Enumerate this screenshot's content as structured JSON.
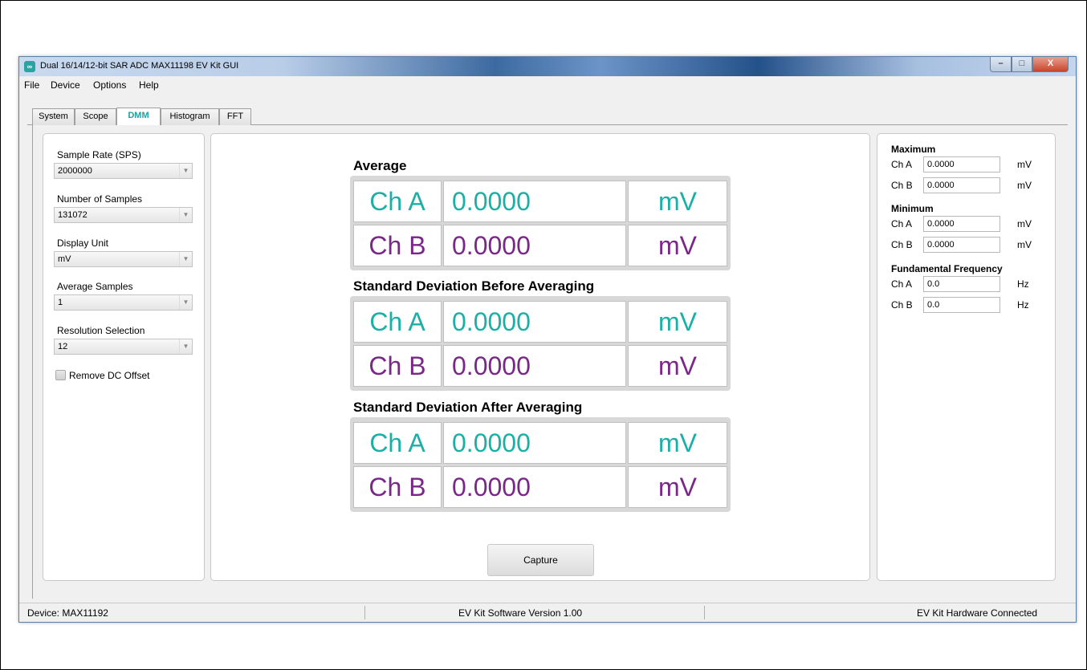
{
  "window": {
    "title": "Dual 16/14/12-bit SAR ADC MAX11198 EV Kit GUI",
    "app_icon_glyph": "∞",
    "controls": {
      "minimize": "–",
      "maximize": "□",
      "close": "X"
    }
  },
  "menu": [
    "File",
    "Device",
    "Options",
    "Help"
  ],
  "tabs": [
    {
      "label": "System",
      "active": false
    },
    {
      "label": "Scope",
      "active": false
    },
    {
      "label": "DMM",
      "active": true
    },
    {
      "label": "Histogram",
      "active": false
    },
    {
      "label": "FFT",
      "active": false
    }
  ],
  "left_panel": {
    "sample_rate": {
      "label": "Sample Rate (SPS)",
      "value": "2000000"
    },
    "num_samples": {
      "label": "Number of Samples",
      "value": "131072"
    },
    "display_unit": {
      "label": "Display Unit",
      "value": "mV"
    },
    "average_samples": {
      "label": "Average Samples",
      "value": "1"
    },
    "resolution": {
      "label": "Resolution Selection",
      "value": "12"
    },
    "remove_dc": {
      "label": "Remove DC Offset",
      "checked": false
    },
    "combo_arrow": "▼"
  },
  "readouts": {
    "average": {
      "title": "Average",
      "rows": [
        {
          "channel": "Ch A",
          "value": "0.0000",
          "unit": "mV"
        },
        {
          "channel": "Ch B",
          "value": "0.0000",
          "unit": "mV"
        }
      ]
    },
    "std_before": {
      "title": "Standard Deviation Before Averaging",
      "rows": [
        {
          "channel": "Ch A",
          "value": "0.0000",
          "unit": "mV"
        },
        {
          "channel": "Ch B",
          "value": "0.0000",
          "unit": "mV"
        }
      ]
    },
    "std_after": {
      "title": "Standard Deviation After Averaging",
      "rows": [
        {
          "channel": "Ch A",
          "value": "0.0000",
          "unit": "mV"
        },
        {
          "channel": "Ch B",
          "value": "0.0000",
          "unit": "mV"
        }
      ]
    },
    "colors": {
      "ch_a": "#1ab0a5",
      "ch_b": "#7a2888"
    }
  },
  "capture_button": "Capture",
  "right_panel": {
    "maximum": {
      "title": "Maximum",
      "rows": [
        {
          "label": "Ch A",
          "value": "0.0000",
          "unit": "mV"
        },
        {
          "label": "Ch B",
          "value": "0.0000",
          "unit": "mV"
        }
      ]
    },
    "minimum": {
      "title": "Minimum",
      "rows": [
        {
          "label": "Ch A",
          "value": "0.0000",
          "unit": "mV"
        },
        {
          "label": "Ch B",
          "value": "0.0000",
          "unit": "mV"
        }
      ]
    },
    "fundamental": {
      "title": "Fundamental Frequency",
      "rows": [
        {
          "label": "Ch A",
          "value": "0.0",
          "unit": "Hz"
        },
        {
          "label": "Ch B",
          "value": "0.0",
          "unit": "Hz"
        }
      ]
    }
  },
  "status": {
    "device": "Device: MAX11192",
    "software": "EV Kit Software Version 1.00",
    "hardware": "EV Kit Hardware Connected"
  }
}
